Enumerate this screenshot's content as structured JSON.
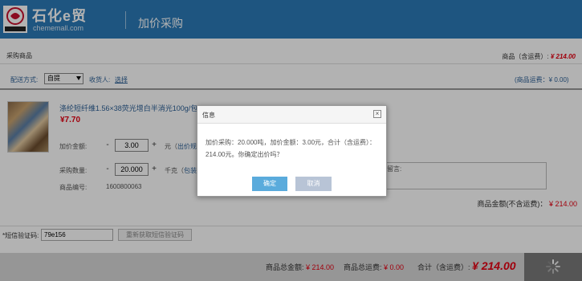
{
  "header": {
    "logo_text": "石化e贸",
    "logo_sub": "chememall.com",
    "page_title": "加价采购"
  },
  "section": {
    "title": "采购商品",
    "total_label": "商品（含运费）:",
    "total_value": "¥ 214.00"
  },
  "delivery": {
    "method_label": "配送方式:",
    "method_value": "自提",
    "receiver_label": "收货人:",
    "receiver_link": "选择",
    "freight": "(商品运费：¥ 0.00)"
  },
  "product": {
    "name": "涤纶短纤维1.56×38荧光增白半消光100g/包",
    "price": "¥7.70",
    "markup_label": "加价金额:",
    "markup_value": "3.00",
    "markup_unit": "元（",
    "markup_unit_link": "出价规",
    "qty_label": "采购数量:",
    "qty_value": "20.000",
    "qty_unit": "千克（",
    "qty_unit_link": "包装",
    "code_label": "商品编号:",
    "code_value": "1600800063",
    "remark_label": "留言:",
    "amount_label": "商品金额(不含运费)：",
    "amount_value": "¥ 214.00"
  },
  "sms": {
    "label": "*短信验证码:",
    "value": "79e156",
    "resend": "重新获取短信验证码"
  },
  "footer": {
    "goods_total_label": "商品总金额:",
    "goods_total_value": "¥ 214.00",
    "freight_total_label": "商品总运费:",
    "freight_total_value": "¥ 0.00",
    "sum_label": "合计（含运费）:",
    "sum_value": "¥ 214.00"
  },
  "dialog": {
    "title": "信息",
    "close": "×",
    "message": "加价采购：20.000吨，加价金额：3.00元，合计（含运费）：214.00元。你确定出价吗？",
    "ok": "确定",
    "cancel": "取消"
  },
  "colors": {
    "header_bg": "#2b7ab8",
    "price_red": "#e60012",
    "ok_button": "#5aabdc",
    "cancel_button": "#b8c4d6"
  }
}
